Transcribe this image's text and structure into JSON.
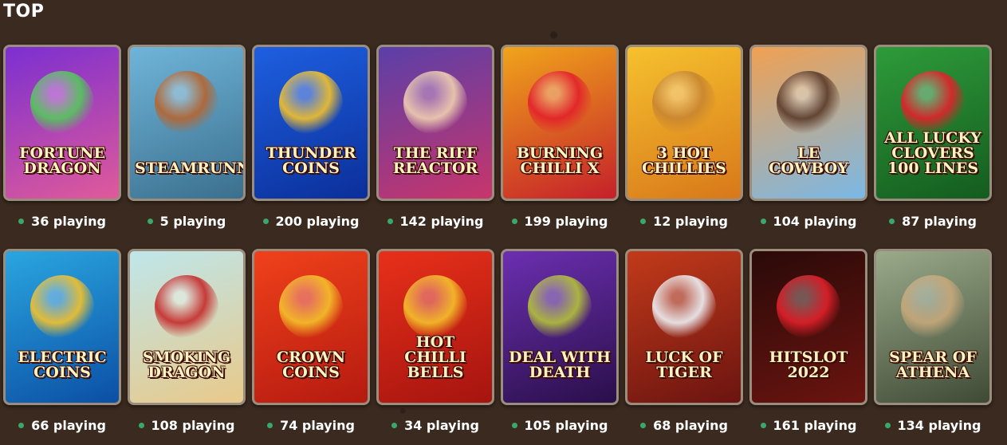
{
  "section_title": "TOP",
  "status_dot_color": "#3aa86b",
  "games": [
    {
      "title": "Fortune Dragon",
      "players": "36 playing",
      "bg": "#7b2fd1",
      "bg2": "#e05a9a",
      "art": "#54c95a",
      "icon": "dragon-art"
    },
    {
      "title": "Steamrunners",
      "players": "5 playing",
      "bg": "#6fb5d9",
      "bg2": "#3b6f8e",
      "art": "#b5652f",
      "icon": "adventurers-art"
    },
    {
      "title": "Thunder Coins",
      "players": "200 playing",
      "bg": "#1e5fe0",
      "bg2": "#0b2f9a",
      "art": "#f5c22b",
      "icon": "lightning-coin-art"
    },
    {
      "title": "The Riff Reactor",
      "players": "142 playing",
      "bg": "#5b3fa8",
      "bg2": "#c8356b",
      "art": "#f0d0b0",
      "icon": "rock-scientist-art"
    },
    {
      "title": "Burning Chilli X",
      "players": "199 playing",
      "bg": "#f0a41b",
      "bg2": "#c5202a",
      "art": "#e3202a",
      "icon": "lucky-seven-art"
    },
    {
      "title": "3 Hot Chillies",
      "players": "12 playing",
      "bg": "#f6c12e",
      "bg2": "#d8781a",
      "art": "#c8852f",
      "icon": "mariachi-art"
    },
    {
      "title": "Le Cowboy",
      "players": "104 playing",
      "bg": "#f0a052",
      "bg2": "#7ab8e6",
      "art": "#5a3a2a",
      "icon": "cowboy-raccoon-art"
    },
    {
      "title": "All Lucky Clovers 100 Lines",
      "players": "87 playing",
      "bg": "#2e9b3a",
      "bg2": "#145c1f",
      "art": "#e3202a",
      "icon": "cherries-art"
    },
    {
      "title": "Electric Coins",
      "players": "66 playing",
      "bg": "#2aa6e0",
      "bg2": "#0b4fa5",
      "art": "#f5c22b",
      "icon": "electric-coin-art"
    },
    {
      "title": "Smoking Dragon",
      "players": "108 playing",
      "bg": "#bfe6ea",
      "bg2": "#e8c98a",
      "art": "#c42a2a",
      "icon": "smoking-dragon-art"
    },
    {
      "title": "Crown Coins",
      "players": "74 playing",
      "bg": "#f0411b",
      "bg2": "#b51a10",
      "art": "#f5c22b",
      "icon": "fruit-coins-art"
    },
    {
      "title": "Hot Chilli Bells",
      "players": "34 playing",
      "bg": "#e8301a",
      "bg2": "#a5140f",
      "art": "#f5c22b",
      "icon": "bell-art"
    },
    {
      "title": "Deal With Death",
      "players": "105 playing",
      "bg": "#6b2fb0",
      "bg2": "#2a0f4a",
      "art": "#b5c23a",
      "icon": "skeletons-art"
    },
    {
      "title": "Luck of Tiger",
      "players": "68 playing",
      "bg": "#c23a1a",
      "bg2": "#6b1410",
      "art": "#eef2f7",
      "icon": "white-tiger-art"
    },
    {
      "title": "Hitslot 2022",
      "players": "161 playing",
      "bg": "#2a0a08",
      "bg2": "#6b1410",
      "art": "#e3202a",
      "icon": "seven-fruits-art"
    },
    {
      "title": "Spear of Athena",
      "players": "134 playing",
      "bg": "#9aaa8a",
      "bg2": "#3f4a35",
      "art": "#c8a87a",
      "icon": "athena-warrior-art"
    }
  ]
}
